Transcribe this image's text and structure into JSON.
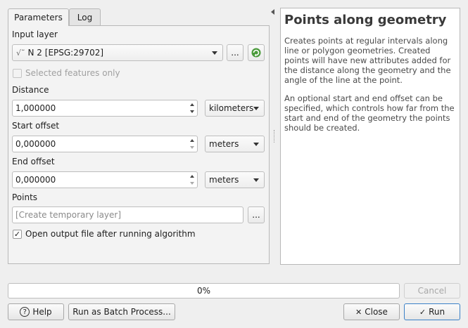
{
  "tabs": [
    {
      "label": "Parameters"
    },
    {
      "label": "Log"
    }
  ],
  "params": {
    "input_layer_label": "Input layer",
    "input_layer_value": "N 2 [EPSG:29702]",
    "layer_icon_glyph": "√˜",
    "ellipsis": "...",
    "selected_only_label": "Selected features only",
    "distance_label": "Distance",
    "distance_value": "1,000000",
    "distance_unit": "kilometers",
    "start_offset_label": "Start offset",
    "start_offset_value": "0,000000",
    "start_offset_unit": "meters",
    "end_offset_label": "End offset",
    "end_offset_value": "0,000000",
    "end_offset_unit": "meters",
    "points_label": "Points",
    "points_placeholder": "[Create temporary layer]",
    "open_output_label": "Open output file after running algorithm",
    "checkmark": "✓"
  },
  "help": {
    "title": "Points along geometry",
    "p1": "Creates points at regular intervals along line or polygon geometries. Created points will have new attributes added for the distance along the geometry and the angle of the line at the point.",
    "p2": "An optional start and end offset can be specified, which controls how far from the start and end of the geometry the points should be created."
  },
  "progress": {
    "value": 0.0,
    "text": "0%"
  },
  "buttons": {
    "cancel": "Cancel",
    "help": "Help",
    "help_icon": "?",
    "batch": "Run as Batch Process...",
    "close": "Close",
    "close_icon": "✕",
    "run": "Run",
    "run_icon": "✓"
  },
  "colors": {
    "accent": "#3b80c7",
    "iterate_icon": "#4a9a3a"
  }
}
